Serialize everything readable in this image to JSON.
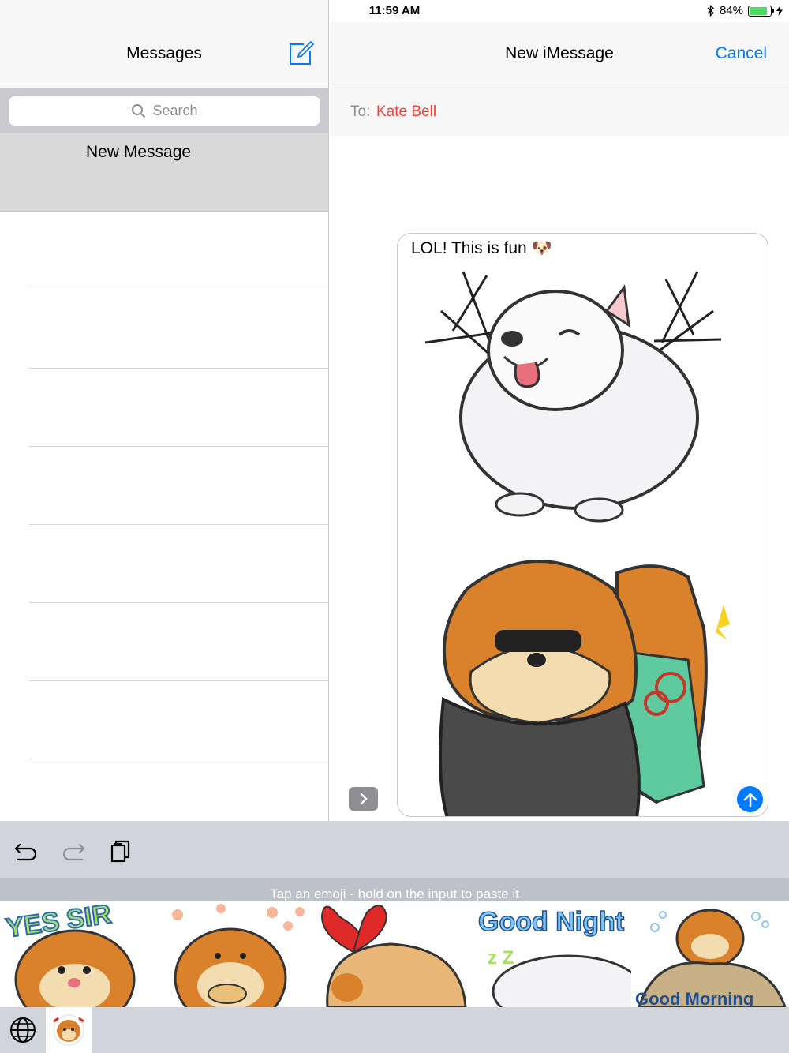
{
  "status_bar": {
    "device": "iPad",
    "time": "11:59 AM",
    "battery": "84%"
  },
  "sidebar": {
    "title": "Messages",
    "search_placeholder": "Search",
    "selected_conversation": "New Message"
  },
  "conversation": {
    "title": "New iMessage",
    "cancel_label": "Cancel",
    "to_label": "To:",
    "recipient": "Kate Bell",
    "draft_text": "LOL! This is fun 🐶"
  },
  "keyboard": {
    "hint": "Tap an emoji - hold on the input to paste it",
    "stickers": [
      {
        "caption": "YES SIR"
      },
      {
        "caption": ""
      },
      {
        "caption": ""
      },
      {
        "caption": "Good Night"
      },
      {
        "caption": "Good Morning"
      }
    ]
  },
  "colors": {
    "accent": "#007aff",
    "recipient": "#ff3b30",
    "battery": "#4cd964",
    "pom_orange": "#d9822b",
    "white_dog": "#f4f4f6"
  }
}
